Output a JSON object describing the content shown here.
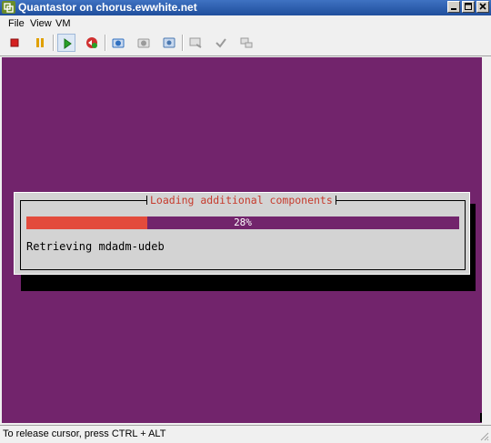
{
  "window": {
    "title": "Quantastor on chorus.ewwhite.net"
  },
  "menu": [
    "File",
    "View",
    "VM"
  ],
  "toolbar": {
    "buttons": [
      {
        "name": "power-off-icon",
        "color": "#d42020"
      },
      {
        "name": "pause-icon",
        "color": "#e0a000"
      },
      {
        "name": "play-icon",
        "color": "#28a028"
      },
      {
        "name": "reset-icon",
        "color": "#d03030"
      },
      {
        "name": "snapshot-icon",
        "color": "#3070c0"
      },
      {
        "name": "revert-snapshot-icon",
        "color": "#9a9a9a"
      },
      {
        "name": "snapshot-manager-icon",
        "color": "#4a78b0"
      },
      {
        "name": "console-icon",
        "color": "#9a9a9a"
      },
      {
        "name": "settings-icon",
        "color": "#9a9a9a"
      },
      {
        "name": "network-icon",
        "color": "#9a9a9a"
      }
    ]
  },
  "dialog": {
    "title": "Loading additional components",
    "progress": {
      "percent": 0.28,
      "label": "28%"
    },
    "status": "Retrieving mdadm-udeb"
  },
  "statusbar": {
    "text": "To release cursor, press CTRL + ALT"
  },
  "colors": {
    "console_bg": "#72246c",
    "progress_fill": "#e34b3c",
    "dialog_title": "#c63a2c"
  }
}
